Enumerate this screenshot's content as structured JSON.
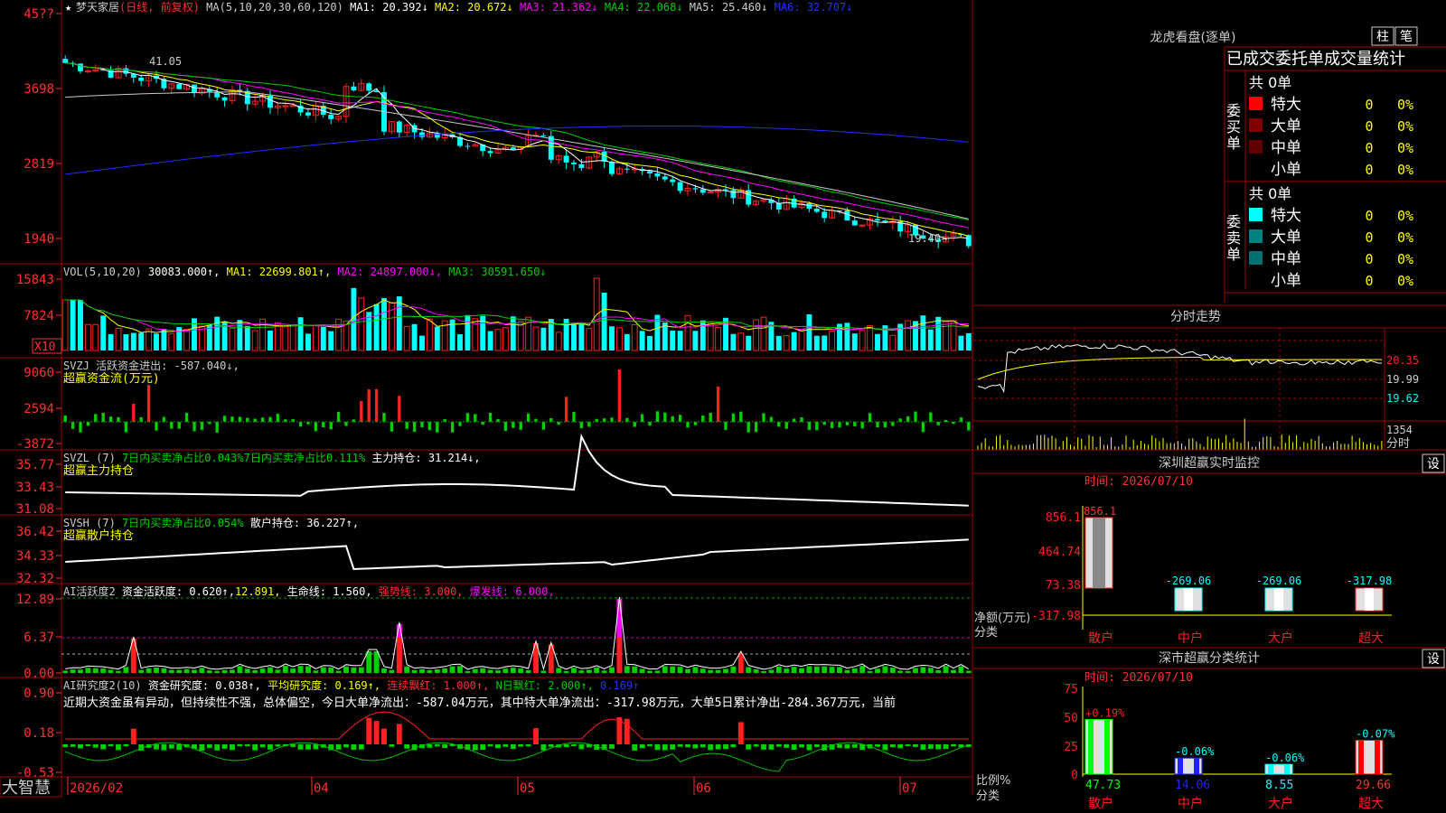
{
  "colors": {
    "up": "#ff2020",
    "down": "#00ffff",
    "grid": "#a00000",
    "axis": "#ff3030",
    "ma1": "#ffffff",
    "ma2": "#ffff00",
    "ma3": "#ff00ff",
    "ma4": "#00cc00",
    "ma5": "#c8c8c8",
    "ma6": "#2030ff",
    "bg": "#000000"
  },
  "main": {
    "stock": "梦天家居",
    "period": "(日线, 前复权)",
    "ma_label": "MA(5,10,20,30,60,120)",
    "ma1": "MA1: 20.392↓",
    "ma2": "MA2: 20.672↓",
    "ma3": "MA3: 21.362↓",
    "ma4": "MA4: 22.068↓",
    "ma5": "MA5: 25.460↓",
    "ma6": "MA6: 32.707↓",
    "yticks": [
      "45??",
      "3698",
      "2819",
      "1940"
    ],
    "hi_label": "41.05",
    "lo_label": "19.40→",
    "ohlc_hint": "candles sampled from screenshot"
  },
  "vol": {
    "title": "VOL(5,10,20)",
    "v": "30083.000↑",
    "ma1": "MA1: 22699.801↑",
    "ma2": "MA2: 24897.000↓",
    "ma3": "MA3: 30591.650↓",
    "yticks": [
      "15843",
      "7824"
    ],
    "unit": "X10"
  },
  "svzj": {
    "title": "SVZJ  活跃资金进出: -587.040↓,",
    "sub": "超赢资金流(万元)",
    "yticks": [
      "9060",
      "2594",
      "-3872"
    ]
  },
  "svzl": {
    "title": "SVZL (7)",
    "g1": "7日内买卖净占比0.043%",
    "g2": "7日内买卖净占比0.111%",
    "main": "主力持仓: 31.214↓,",
    "sub": "超赢主力持仓",
    "yticks": [
      "35.77",
      "33.43",
      "31.08"
    ]
  },
  "svsh": {
    "title": "SVSH (7)",
    "g1": "7日内买卖净占比0.054%",
    "main": "散户持仓: 36.227↑,",
    "sub": "超赢散户持仓",
    "yticks": [
      "36.42",
      "34.33",
      "32.32"
    ]
  },
  "ai1": {
    "title": "AI活跃度2",
    "a": "资金活跃度: 0.620↑,",
    "b": "12.891,",
    "c": "生命线: 1.560,",
    "d": "强势线: 3.000,",
    "e": "爆发线: 6.000,",
    "yticks": [
      "12.89",
      "6.37",
      "0.00"
    ]
  },
  "ai2": {
    "title": "AI研究度2(10)",
    "a": "资金研究度: 0.038↑,",
    "b": "平均研究度: 0.169↑,",
    "c": "连续飘红: 1.000↑,",
    "d": "N日飘红: 2.000↑,",
    "e": "0.169↑",
    "yticks": [
      "0.90",
      "0.18",
      "-0.53"
    ],
    "comment": "近期大资金虽有异动，但持续性不强，总体偏空，今日大单净流出：-587.04万元，其中特大单净流出：-317.98万元，大单5日累计净出-284.367万元，当前"
  },
  "xaxis": {
    "labels": [
      "2026/02",
      "04",
      "05",
      "06",
      "07"
    ],
    "logo": "大智慧"
  },
  "side": {
    "lh_title": "龙虎看盘(逐单)",
    "btn1": "柱",
    "btn2": "笔",
    "stat_title": "已成交委托单成交量统计",
    "buy": {
      "label": "委买单",
      "total": "共 0单",
      "rows": [
        {
          "name": "特大",
          "v": "0",
          "p": "0%"
        },
        {
          "name": "大单",
          "v": "0",
          "p": "0%"
        },
        {
          "name": "中单",
          "v": "0",
          "p": "0%"
        },
        {
          "name": "小单",
          "v": "0",
          "p": "0%"
        }
      ]
    },
    "sell": {
      "label": "委卖单",
      "total": "共 0单",
      "rows": [
        {
          "name": "特大",
          "v": "0",
          "p": "0%"
        },
        {
          "name": "大单",
          "v": "0",
          "p": "0%"
        },
        {
          "name": "中单",
          "v": "0",
          "p": "0%"
        },
        {
          "name": "小单",
          "v": "0",
          "p": "0%"
        }
      ]
    },
    "ts_title": "分时走势",
    "ts_y": [
      "20.35",
      "19.99",
      "19.62"
    ],
    "ts_vol": "1354",
    "ts_label": "分时",
    "mon_title": "深圳超赢实时监控",
    "set": "设",
    "time": "时间: 2026/07/10",
    "mon_y": [
      "856.1",
      "464.74",
      "73.38",
      "-317.98"
    ],
    "mon_ylab": "净额(万元)",
    "mon_xlab": "分类",
    "mon_vals": [
      "856.1",
      "-269.06",
      "-269.06",
      "-317.98"
    ],
    "cats": [
      "散户",
      "中户",
      "大户",
      "超大"
    ],
    "cls_title": "深市超赢分类统计",
    "cls_time": "时间: 2026/07/10",
    "cls_y": [
      "75",
      "50",
      "25",
      "0"
    ],
    "cls_ylab": "比例%",
    "cls_xlab": "分类",
    "cls_top": [
      "+0.19%",
      "-0.06%",
      "-0.06%",
      "-0.07%"
    ],
    "cls_vals": [
      "47.73",
      "14.06",
      "8.55",
      "29.66"
    ]
  },
  "chart_data": {
    "type": "candlestick",
    "title": "梦天家居 (日线, 前复权)",
    "ylim": [
      19.4,
      45.77
    ],
    "note": "approximate downtrend from ~41 to ~19.4"
  }
}
